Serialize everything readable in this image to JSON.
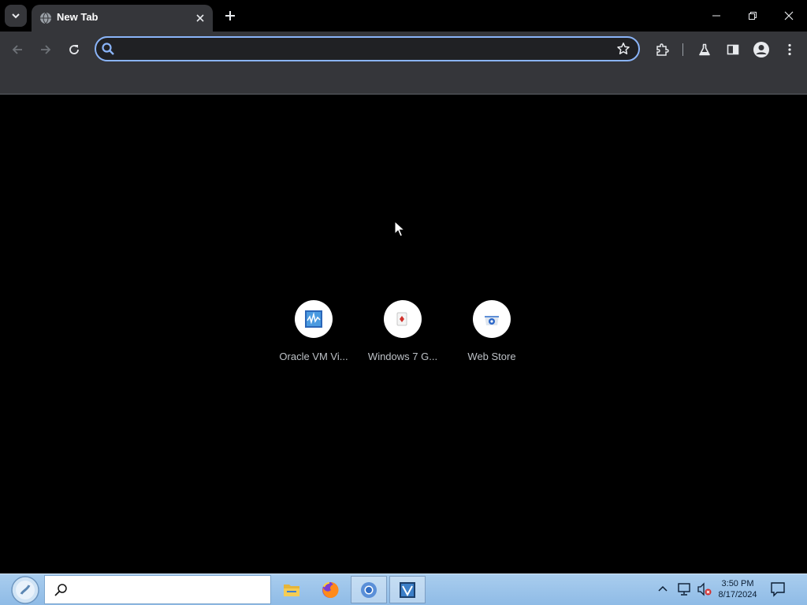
{
  "tab": {
    "title": "New Tab"
  },
  "omnibox": {
    "value": "",
    "placeholder": ""
  },
  "shortcuts": [
    {
      "label": "Oracle VM Vi..."
    },
    {
      "label": "Windows 7 G..."
    },
    {
      "label": "Web Store"
    }
  ],
  "taskbar": {
    "time": "3:50 PM",
    "date": "8/17/2024",
    "apps": [
      "file-explorer",
      "firefox",
      "chrome",
      "virtualbox"
    ]
  },
  "colors": {
    "page_bg": "#000000",
    "toolbar_bg": "#35363a",
    "omnibox_focus": "#8ab4f8",
    "taskbar_bg": "#9fc7ec"
  }
}
